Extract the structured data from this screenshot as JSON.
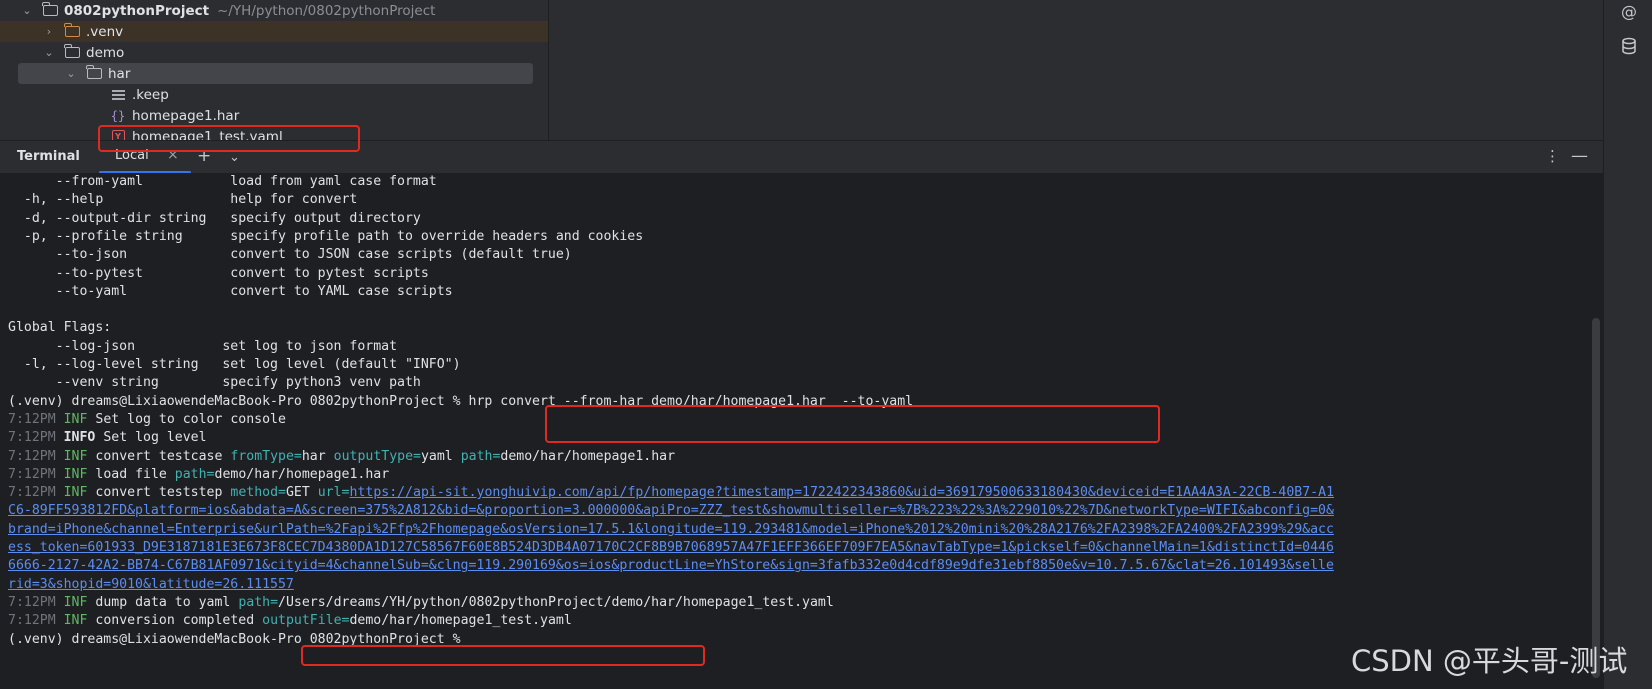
{
  "tree": {
    "root_name": "0802pythonProject",
    "root_path": "~/YH/python/0802pythonProject",
    "items": [
      {
        "label": ".venv"
      },
      {
        "label": "demo"
      },
      {
        "label": "har"
      },
      {
        "label": ".keep"
      },
      {
        "label": "homepage1.har"
      },
      {
        "label": "homepage1_test.yaml"
      }
    ]
  },
  "terminal": {
    "title": "Terminal",
    "tab_label": "Local",
    "help_lines": [
      "      --from-yaml           load from yaml case format",
      "  -h, --help                help for convert",
      "  -d, --output-dir string   specify output directory",
      "  -p, --profile string      specify profile path to override headers and cookies",
      "      --to-json             convert to JSON case scripts (default true)",
      "      --to-pytest           convert to pytest scripts",
      "      --to-yaml             convert to YAML case scripts",
      "",
      "Global Flags:",
      "      --log-json           set log to json format",
      "  -l, --log-level string   set log level (default \"INFO\")",
      "      --venv string        specify python3 venv path"
    ],
    "prompt": "(.venv) dreams@LixiaowendeMacBook-Pro 0802pythonProject % ",
    "command": "hrp convert --from-har demo/har/homepage1.har  --to-yaml",
    "time": "7:12PM",
    "inf": "INF",
    "info": "INFO",
    "msg_set_color": "Set log to color console",
    "msg_set_level": "Set log level",
    "msg_convert_testcase": "convert testcase",
    "k_fromType": "fromType=",
    "v_fromType": "har",
    "k_outputType": "outputType=",
    "v_outputType": "yaml",
    "k_path": "path=",
    "v_path_har": "demo/har/homepage1.har",
    "msg_load": "load file",
    "v_load_path": "demo/har/homepage1.har",
    "msg_convert_step": "convert teststep",
    "k_method": "method=",
    "v_method": "GET",
    "k_url": "url=",
    "url_lines": [
      "https://api-sit.yonghuivip.com/api/fp/homepage?timestamp=1722422343860&uid=369179500633180430&deviceid=E1AA4A3A-22CB-40B7-A1",
      "C6-89FF593812FD&platform=ios&abdata=A&screen=375%2A812&bid=&proportion=3.000000&apiPro=ZZZ_test&showmultiseller=%7B%223%22%3A%229010%22%7D&networkType=WIFI&abconfig=0&",
      "brand=iPhone&channel=Enterprise&urlPath=%2Fapi%2Ffp%2Fhomepage&osVersion=17.5.1&longitude=119.293481&model=iPhone%2012%20mini%20%28A2176%2FA2398%2FA2400%2FA2399%29&acc",
      "ess_token=601933_D9E3187181E3E673F8CEC7D4380DA1D127C58567F60E8B524D3DB4A07170C2CF8B9B7068957A47F1EFF366EF709F7EA5&navTabType=1&pickself=0&channelMain=1&distinctId=0446",
      "6666-2127-42A2-BB74-C67B81AF0971&cityid=4&channelSub=&clng=119.290169&os=ios&productLine=YhStore&sign=3fafb332e0d4cdf89e9dfe31ebf8850e&v=10.7.5.67&clat=26.101493&selle",
      "rid=3&shopid=9010&latitude=26.111557"
    ],
    "msg_dump": "dump data to yaml",
    "v_dump_path": "/Users/dreams/YH/python/0802pythonProject/demo/har/homepage1_test.yaml",
    "msg_done": "conversion completed",
    "k_outputFile": "outputFile=",
    "v_outputFile": "demo/har/homepage1_test.yaml",
    "final_prompt": "(.venv) dreams@LixiaowendeMacBook-Pro 0802pythonProject % "
  },
  "watermark": "CSDN @平头哥-测试",
  "colors": {
    "annotation_red": "#e02a20",
    "inf_green": "#5fb865",
    "key_teal": "#3fb2b2",
    "link_blue": "#5c8df0"
  }
}
